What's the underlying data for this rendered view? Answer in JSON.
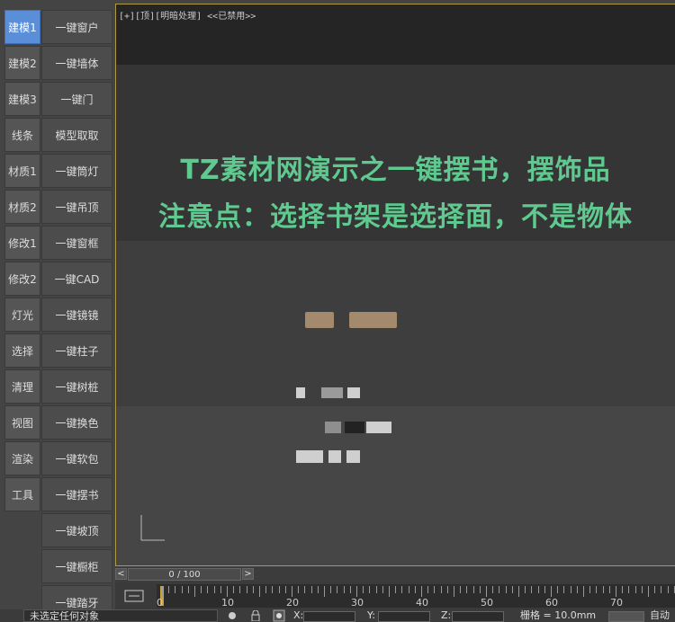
{
  "tabs": [
    "建模1",
    "建模2",
    "建模3",
    "线条",
    "材质1",
    "材质2",
    "修改1",
    "修改2",
    "灯光",
    "选择",
    "清理",
    "视图",
    "渲染",
    "工具"
  ],
  "buttons": [
    "一键窗户",
    "一键墙体",
    "一键门",
    "模型取取",
    "一键筒灯",
    "一键吊顶",
    "一键窗框",
    "一键CAD",
    "一键镜镜",
    "一键柱子",
    "一键树桩",
    "一键换色",
    "一键软包",
    "一键摆书",
    "一键坡顶",
    "一键橱柜",
    "一键踏牙"
  ],
  "viewport": {
    "label": "[+][顶][明暗处理] <<已禁用>>",
    "banner_line1": "TZ素材网演示之一键摆书，摆饰品",
    "banner_line2": "注意点：选择书架是选择面，不是物体"
  },
  "timeline": {
    "prev": "<",
    "position": "0 / 100",
    "next": ">"
  },
  "ruler": {
    "labels": [
      "0",
      "10",
      "20",
      "30",
      "40",
      "50",
      "60",
      "70"
    ]
  },
  "status": {
    "message": "未选定任何对象",
    "x_label": "X:",
    "y_label": "Y:",
    "z_label": "Z:",
    "grid": "栅格 = 10.0mm",
    "auto": "自动"
  },
  "colors": {
    "active_tab": "#5a8ed8",
    "banner_text": "#5fc98f",
    "viewport_border": "#b19a42"
  }
}
